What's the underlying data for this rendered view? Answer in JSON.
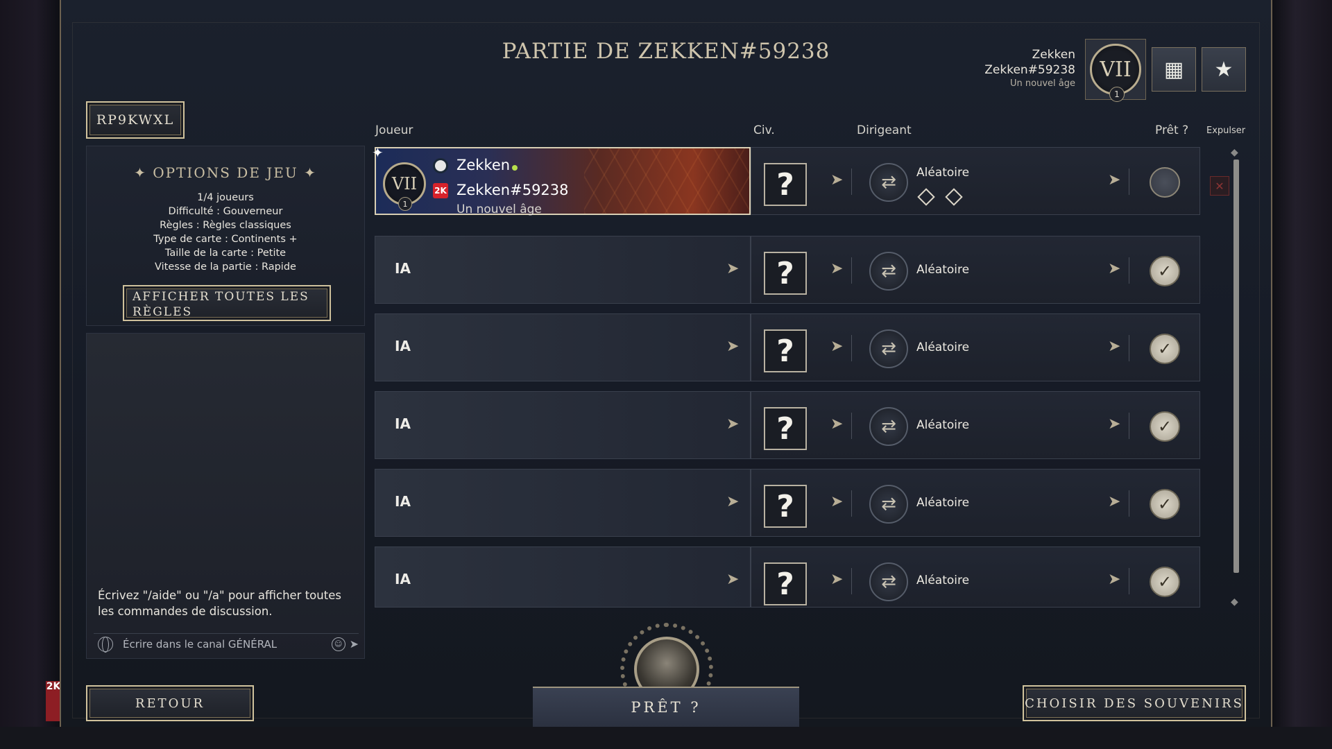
{
  "title": "PARTIE DE ZEKKEN#59238",
  "profile": {
    "name": "Zekken",
    "tag": "Zekken#59238",
    "age": "Un nouvel âge",
    "emblem": "VII",
    "level": "1",
    "icons": [
      "players-icon",
      "mementos-icon"
    ]
  },
  "lobby_code": "RP9KWXL",
  "options": {
    "title": "OPTIONS DE JEU",
    "lines": [
      "1/4 joueurs",
      "Difficulté : Gouverneur",
      "Règles : Règles classiques",
      "Type de carte : Continents +",
      "Taille de la carte : Petite",
      "Vitesse de la partie : Rapide"
    ],
    "rules_button": "AFFICHER TOUTES LES RÈGLES"
  },
  "chat": {
    "hint": "Écrivez \"/aide\" ou \"/a\" pour afficher toutes les commandes de discussion.",
    "placeholder": "Écrire dans le canal GÉNÉRAL"
  },
  "columns": {
    "player": "Joueur",
    "civ": "Civ.",
    "leader": "Dirigeant",
    "ready": "Prêt ?",
    "kick": "Expulser"
  },
  "rows": [
    {
      "type": "human",
      "name": "Zekken",
      "tag": "Zekken#59238",
      "age": "Un nouvel âge",
      "emblem": "VII",
      "level": "1",
      "civ": "?",
      "leader": "Aléatoire",
      "ready": false
    },
    {
      "type": "ai",
      "name": "IA",
      "civ": "?",
      "leader": "Aléatoire",
      "ready": true
    },
    {
      "type": "ai",
      "name": "IA",
      "civ": "?",
      "leader": "Aléatoire",
      "ready": true
    },
    {
      "type": "ai",
      "name": "IA",
      "civ": "?",
      "leader": "Aléatoire",
      "ready": true
    },
    {
      "type": "ai",
      "name": "IA",
      "civ": "?",
      "leader": "Aléatoire",
      "ready": true
    },
    {
      "type": "ai",
      "name": "IA",
      "civ": "?",
      "leader": "Aléatoire",
      "ready": true
    }
  ],
  "buttons": {
    "back": "RETOUR",
    "ready": "PRÊT ?",
    "mementos": "CHOISIR DES SOUVENIRS"
  },
  "colors": {
    "accent_gold": "#d1c39d",
    "background": "#161b26",
    "online": "#b8e04c"
  }
}
